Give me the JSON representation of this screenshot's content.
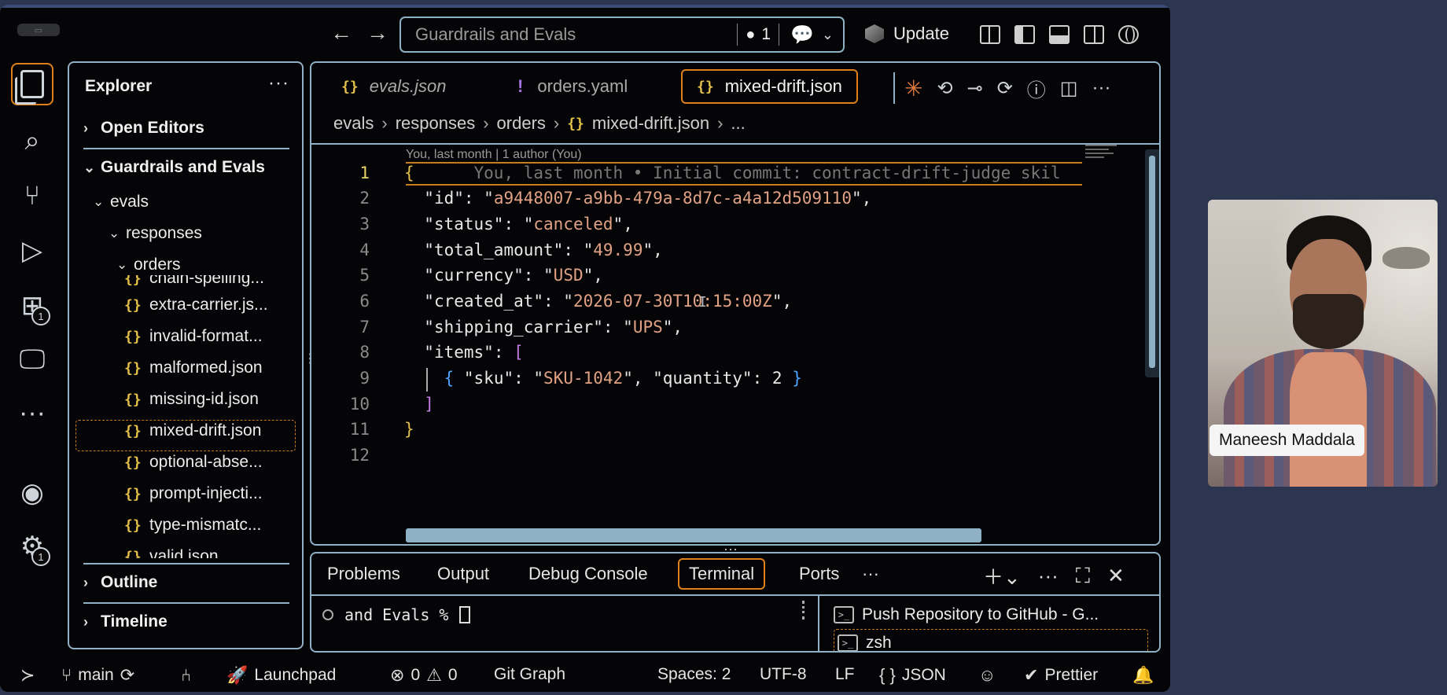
{
  "window": {
    "nav_back": "←",
    "nav_forward": "→",
    "command_center": {
      "text": "Guardrails and Evals",
      "changes_dot": "●",
      "changes_count": "1"
    },
    "update_label": "Update"
  },
  "activity_bar": {
    "extensions_badge": "1",
    "settings_badge": "1"
  },
  "explorer": {
    "title": "Explorer",
    "more": "···",
    "open_editors": "Open Editors",
    "workspace": "Guardrails and Evals",
    "folders": [
      "evals",
      "responses",
      "orders"
    ],
    "files": [
      "chain-spelling...",
      "extra-carrier.js...",
      "invalid-format...",
      "malformed.json",
      "missing-id.json",
      "mixed-drift.json",
      "optional-abse...",
      "prompt-injecti...",
      "type-mismatc...",
      "valid.json"
    ],
    "selected_file": "mixed-drift.json",
    "outline": "Outline",
    "timeline": "Timeline"
  },
  "editor": {
    "tabs": [
      {
        "icon": "{}",
        "label": "evals.json",
        "italic": true
      },
      {
        "icon": "!",
        "label": "orders.yaml",
        "italic": false
      },
      {
        "icon": "{}",
        "label": "mixed-drift.json",
        "active": true
      }
    ],
    "breadcrumb": [
      "evals",
      "responses",
      "orders",
      "mixed-drift.json",
      "..."
    ],
    "blame_header": "You, last month | 1 author (You)",
    "blame_inline": "You, last month • Initial commit: contract-drift-judge skil",
    "line_numbers": [
      "1",
      "2",
      "3",
      "4",
      "5",
      "6",
      "7",
      "8",
      "9",
      "10",
      "11",
      "12"
    ],
    "json": {
      "id": "a9448007-a9bb-479a-8d7c-a4a12d509110",
      "status": "canceled",
      "total_amount": "49.99",
      "currency": "USD",
      "created_at": "2026-07-30T10:15:00Z",
      "shipping_carrier": "UPS",
      "items_sku": "SKU-1042",
      "items_quantity": "2"
    }
  },
  "panel": {
    "tabs": [
      "Problems",
      "Output",
      "Debug Console",
      "Terminal",
      "Ports",
      "···"
    ],
    "active_tab": "Terminal",
    "prompt": "and Evals %",
    "terminals": [
      "Push Repository to GitHub - G...",
      "zsh"
    ]
  },
  "status_bar": {
    "branch": "main",
    "launchpad": "Launchpad",
    "errors": "0",
    "warnings": "0",
    "git_graph": "Git Graph",
    "spaces": "Spaces: 2",
    "encoding": "UTF-8",
    "eol": "LF",
    "language": "JSON",
    "prettier": "Prettier"
  },
  "webcam": {
    "name": "Maneesh Maddala"
  },
  "colors": {
    "accent_border": "#8fb1c5",
    "active_orange": "#e0801a",
    "json_icon": "#e5c04a",
    "string": "#e0a184"
  }
}
